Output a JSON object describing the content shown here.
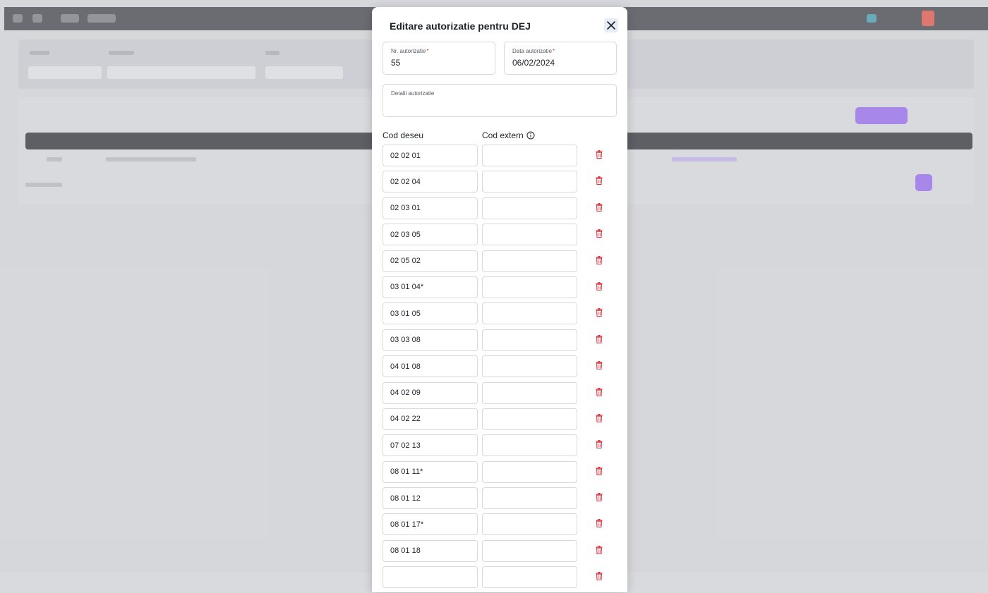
{
  "modal": {
    "title": "Editare autorizatie pentru DEJ",
    "nr_label": "Nr. autorizatie",
    "nr_value": "55",
    "date_label": "Data autorizatie",
    "date_value": "06/02/2024",
    "details_label": "Detalii autorizatie",
    "details_value": "",
    "col_cod_deseu": "Cod deseu",
    "col_cod_extern": "Cod extern",
    "required_mark": "*",
    "codes": [
      "02 02 01",
      "02 02 04",
      "02 03 01",
      "02 03 05",
      "02 05 02",
      "03 01 04*",
      "03 01 05",
      "03 03 08",
      "04 01 08",
      "04 02 09",
      "04 02 22",
      "07 02 13",
      "08 01 11*",
      "08 01 12",
      "08 01 17*",
      "08 01 18",
      ""
    ]
  },
  "icons": {
    "close": "close-icon",
    "info": "info-icon",
    "delete": "trash-icon"
  },
  "colors": {
    "accent_purple": "#a37cf0",
    "delete_red": "#e0303a",
    "close_bg": "#e8ecf6"
  }
}
